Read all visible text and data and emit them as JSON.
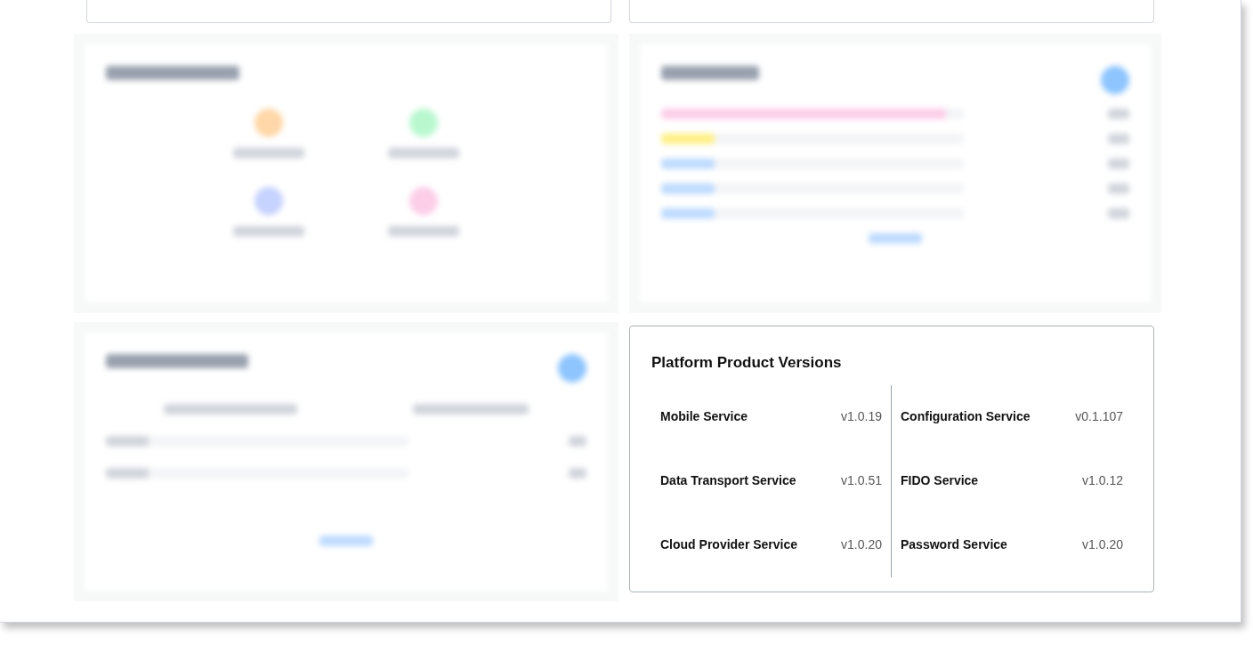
{
  "versions_card": {
    "title": "Platform Product Versions",
    "columns": [
      {
        "items": [
          {
            "name": "Mobile Service",
            "version": "v1.0.19"
          },
          {
            "name": "Data Transport Service",
            "version": "v1.0.51"
          },
          {
            "name": "Cloud Provider Service",
            "version": "v1.0.20"
          }
        ]
      },
      {
        "items": [
          {
            "name": "Configuration Service",
            "version": "v0.1.107"
          },
          {
            "name": "FIDO Service",
            "version": "v1.0.12"
          },
          {
            "name": "Password Service",
            "version": "v1.0.20"
          }
        ]
      }
    ]
  }
}
